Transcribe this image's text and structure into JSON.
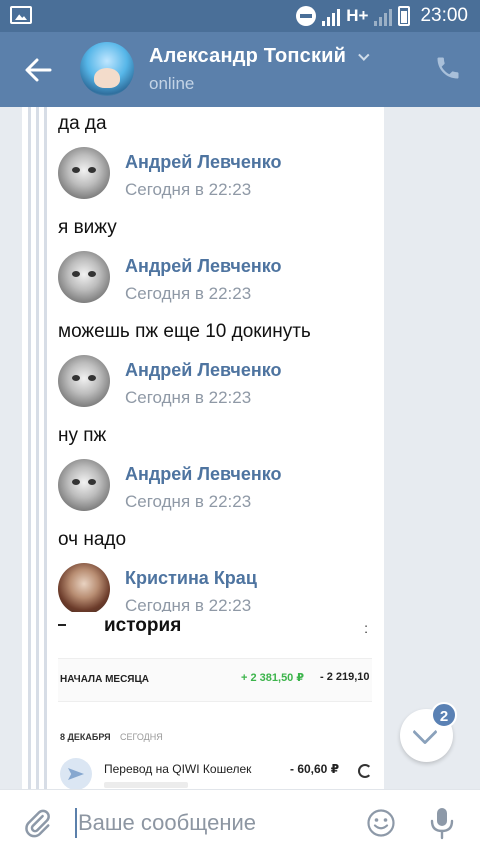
{
  "status_bar": {
    "network": "H+",
    "time": "23:00"
  },
  "header": {
    "contact_name": "Александр Топский",
    "status": "online"
  },
  "messages": [
    {
      "type": "text",
      "text": "да да"
    },
    {
      "type": "author",
      "name": "Андрей Левченко",
      "time": "Сегодня в 22:23"
    },
    {
      "type": "text",
      "text": "я вижу"
    },
    {
      "type": "author",
      "name": "Андрей Левченко",
      "time": "Сегодня в 22:23"
    },
    {
      "type": "text",
      "text": "можешь пж еще 10 докинуть"
    },
    {
      "type": "author",
      "name": "Андрей Левченко",
      "time": "Сегодня в 22:23"
    },
    {
      "type": "text",
      "text": "ну пж"
    },
    {
      "type": "author",
      "name": "Андрей Левченко",
      "time": "Сегодня в 22:23"
    },
    {
      "type": "text",
      "text": "оч надо"
    },
    {
      "type": "author",
      "name": "Кристина Крац",
      "time": "Сегодня в 22:23"
    }
  ],
  "embedded_screenshot": {
    "title": "история",
    "month_label": "НАЧАЛА МЕСЯЦА",
    "income": "+ 2 381,50 ₽",
    "expense": "- 2 219,10",
    "date_label": "8 ДЕКАБРЯ",
    "today_label": "СЕГОДНЯ",
    "transaction_label": "Перевод на QIWI Кошелек",
    "transaction_amount": "- 60,60 ₽"
  },
  "scroll_fab": {
    "unread_count": "2"
  },
  "composer": {
    "placeholder": "Ваше сообщение"
  },
  "colors": {
    "status_bar": "#4a6f98",
    "header": "#5b80ab",
    "accent_name": "#4e74a0",
    "background": "#e7ebf0"
  },
  "icons": [
    "image-icon",
    "dnd-icon",
    "signal-icon",
    "battery-icon",
    "back-arrow-icon",
    "phone-icon",
    "chevron-down-icon",
    "paperclip-icon",
    "smile-icon",
    "microphone-icon"
  ]
}
